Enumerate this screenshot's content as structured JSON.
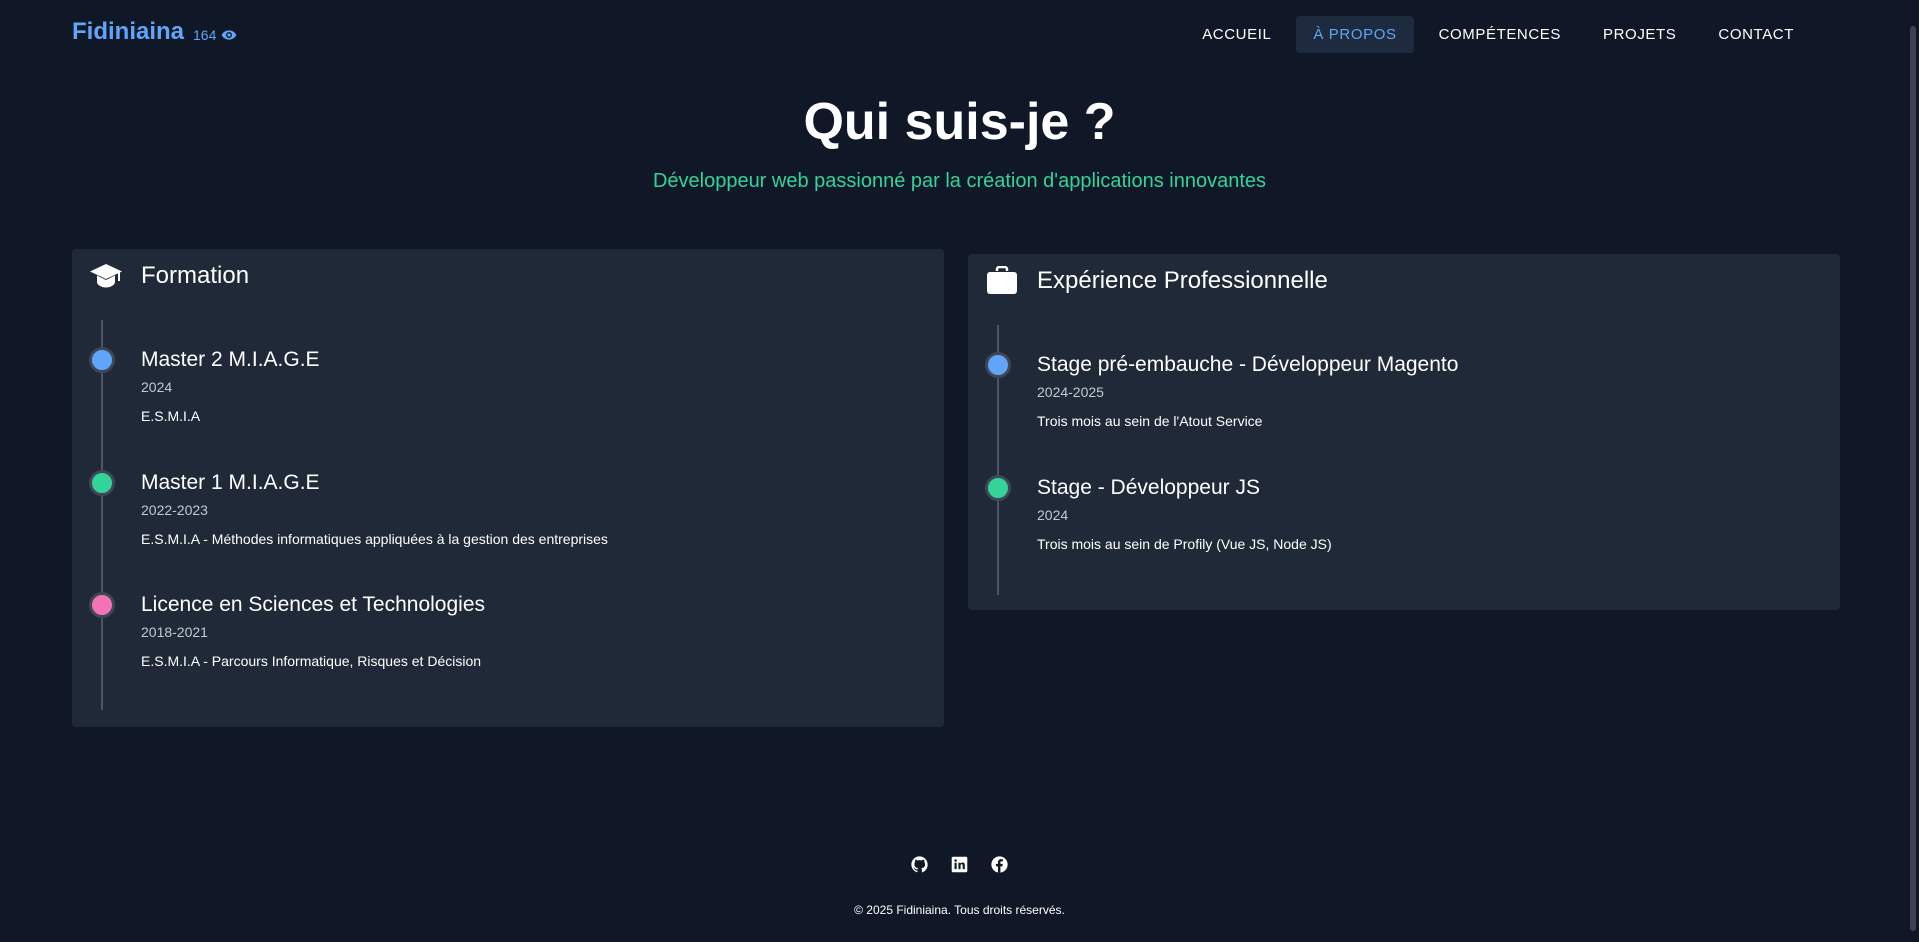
{
  "header": {
    "brand": "Fidiniaina",
    "view_count": "164",
    "view_icon": "eye-icon",
    "nav": [
      {
        "label": "ACCUEIL"
      },
      {
        "label": "À PROPOS",
        "active": true
      },
      {
        "label": "COMPÉTENCES"
      },
      {
        "label": "PROJETS"
      },
      {
        "label": "CONTACT"
      }
    ]
  },
  "hero": {
    "title": "Qui suis-je ?",
    "subtitle": "Développeur web passionné par la création d'applications innovantes"
  },
  "formation": {
    "icon": "graduation-cap-icon",
    "title": "Formation",
    "items": [
      {
        "title": "Master 2 M.I.A.G.E",
        "year": "2024",
        "desc": "E.S.M.I.A",
        "dot_color": "#60a5fa"
      },
      {
        "title": "Master 1 M.I.A.G.E",
        "year": "2022-2023",
        "desc": "E.S.M.I.A - Méthodes informatiques appliquées à la gestion des entreprises",
        "dot_color": "#34d399"
      },
      {
        "title": "Licence en Sciences et Technologies",
        "year": "2018-2021",
        "desc": "E.S.M.I.A - Parcours Informatique, Risques et Décision",
        "dot_color": "#f472b6"
      }
    ]
  },
  "experience": {
    "icon": "briefcase-icon",
    "title": "Expérience Professionnelle",
    "items": [
      {
        "title": "Stage pré-embauche - Développeur Magento",
        "year": "2024-2025",
        "desc": "Trois mois au sein de l'Atout Service",
        "dot_color": "#60a5fa"
      },
      {
        "title": "Stage - Développeur JS",
        "year": "2024",
        "desc": "Trois mois au sein de Profily (Vue JS, Node JS)",
        "dot_color": "#34d399"
      }
    ]
  },
  "footer": {
    "socials": [
      "github-icon",
      "linkedin-icon",
      "facebook-icon"
    ],
    "copyright": "© 2025 Fidiniaina. Tous droits réservés."
  },
  "colors": {
    "background": "#101827",
    "card": "#1f2937",
    "accent_blue": "#60a5fa",
    "accent_green": "#34d399",
    "accent_pink": "#f472b6"
  }
}
